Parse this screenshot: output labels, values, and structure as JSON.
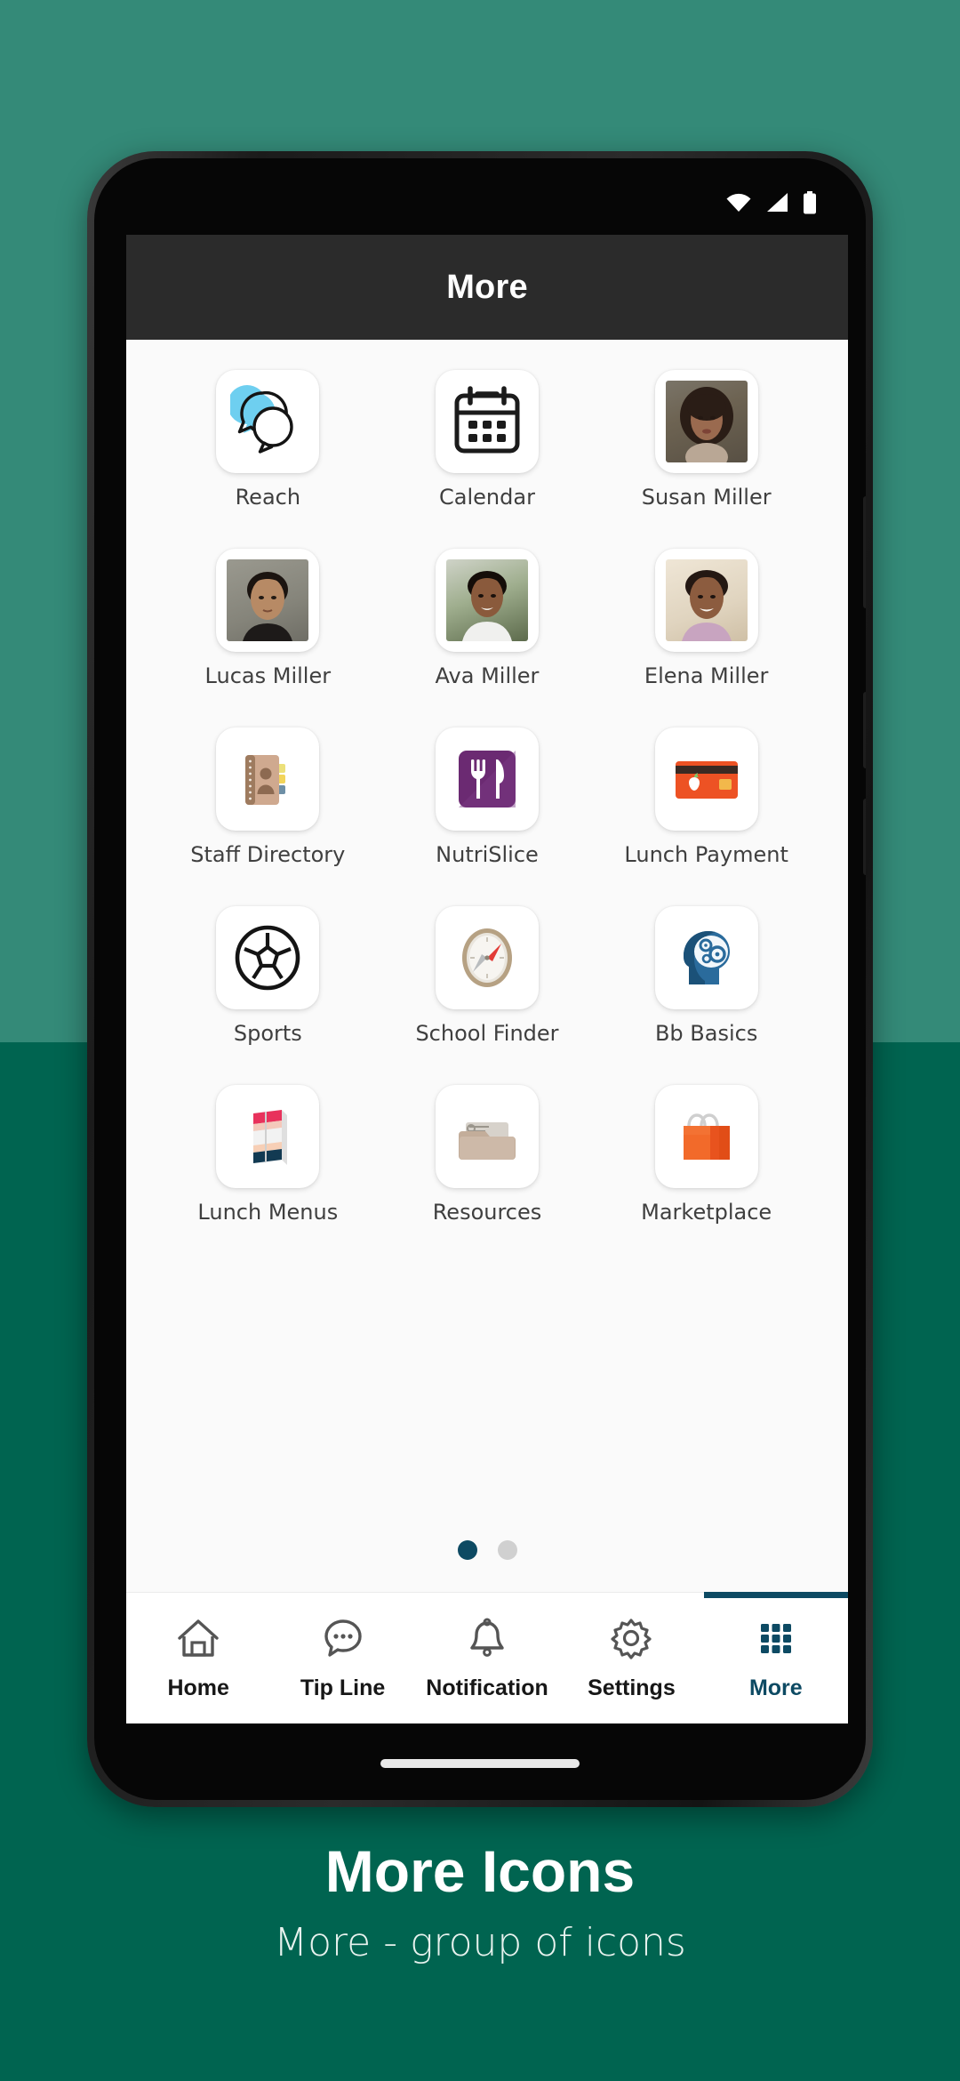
{
  "background": {
    "top_color": "#348a78",
    "bottom_color": "#006450"
  },
  "statusbar": {
    "icons": [
      "wifi-icon",
      "cell-signal-icon",
      "battery-icon"
    ]
  },
  "appbar": {
    "title": "More"
  },
  "grid": {
    "items": [
      {
        "label": "Reach",
        "icon": "reach-chat-bubbles-icon"
      },
      {
        "label": "Calendar",
        "icon": "calendar-icon"
      },
      {
        "label": "Susan Miller",
        "icon": "avatar-photo"
      },
      {
        "label": "Lucas Miller",
        "icon": "avatar-photo"
      },
      {
        "label": "Ava Miller",
        "icon": "avatar-photo"
      },
      {
        "label": "Elena Miller",
        "icon": "avatar-photo"
      },
      {
        "label": "Staff Directory",
        "icon": "address-book-icon"
      },
      {
        "label": "NutriSlice",
        "icon": "fork-knife-icon"
      },
      {
        "label": "Lunch Payment",
        "icon": "credit-card-icon"
      },
      {
        "label": "Sports",
        "icon": "soccer-ball-icon"
      },
      {
        "label": "School Finder",
        "icon": "compass-icon"
      },
      {
        "label": "Bb Basics",
        "icon": "head-gears-icon"
      },
      {
        "label": "Lunch Menus",
        "icon": "folded-menu-icon"
      },
      {
        "label": "Resources",
        "icon": "folder-icon"
      },
      {
        "label": "Marketplace",
        "icon": "shopping-bags-icon"
      }
    ]
  },
  "pagination": {
    "total_pages": 2,
    "current_page": 1,
    "active_color": "#0d4a63",
    "inactive_color": "#d0d0d0"
  },
  "bottom_nav": {
    "active_color": "#0d4a63",
    "items": [
      {
        "label": "Home",
        "icon": "home-icon",
        "active": false
      },
      {
        "label": "Tip Line",
        "icon": "chat-bubble-icon",
        "active": false
      },
      {
        "label": "Notification",
        "icon": "bell-icon",
        "active": false
      },
      {
        "label": "Settings",
        "icon": "gear-icon",
        "active": false
      },
      {
        "label": "More",
        "icon": "grid-dots-icon",
        "active": true
      }
    ]
  },
  "caption": {
    "title": "More Icons",
    "subtitle": "More - group of icons"
  }
}
